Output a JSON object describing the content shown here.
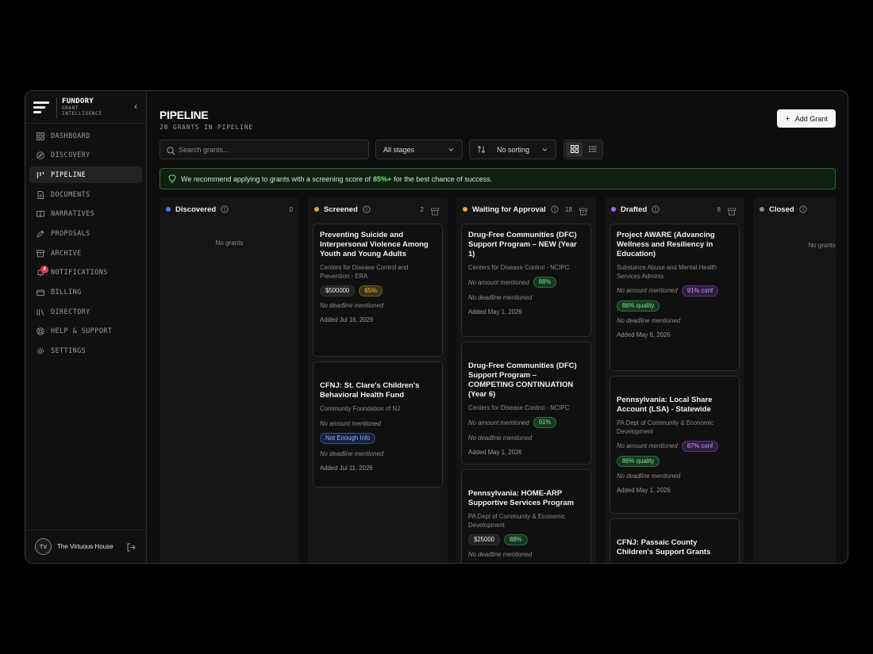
{
  "colors": {
    "discovered": "#3f7df0",
    "screened": "#e8a33d",
    "waiting": "#f0a22e",
    "drafted": "#a861e8",
    "closed": "#8a8a8a",
    "tip_accent": "#7ee081",
    "badge": "#e0324b"
  },
  "brand": {
    "name": "FUNDORY",
    "tagline": "GRANT INTELLIGENCE"
  },
  "sidebar": {
    "items": [
      {
        "label": "DASHBOARD",
        "icon": "grid-icon"
      },
      {
        "label": "DISCOVERY",
        "icon": "compass-icon"
      },
      {
        "label": "PIPELINE",
        "icon": "pipeline-icon",
        "active": true
      },
      {
        "label": "DOCUMENTS",
        "icon": "document-icon"
      },
      {
        "label": "NARRATIVES",
        "icon": "book-icon"
      },
      {
        "label": "PROPOSALS",
        "icon": "pen-icon"
      },
      {
        "label": "ARCHIVE",
        "icon": "archive-icon"
      },
      {
        "label": "NOTIFICATIONS",
        "icon": "bell-icon",
        "badge": "4"
      },
      {
        "label": "BILLING",
        "icon": "card-icon"
      },
      {
        "label": "DIRECTORY",
        "icon": "library-icon"
      },
      {
        "label": "HELP & SUPPORT",
        "icon": "lifebuoy-icon"
      },
      {
        "label": "SETTINGS",
        "icon": "gear-icon"
      }
    ]
  },
  "user": {
    "initials": "TV",
    "name": "The Virtuous House"
  },
  "header": {
    "title": "PIPELINE",
    "subtitle": "28 GRANTS IN PIPELINE",
    "add_label": "Add Grant"
  },
  "toolbar": {
    "search_placeholder": "Search grants...",
    "stage_filter": "All stages",
    "sort": "No sorting",
    "view": "grid"
  },
  "tip": {
    "prefix": "We recommend applying to grants with a screening score of",
    "highlight": "85%+",
    "suffix": "for the best chance of success."
  },
  "columns": {
    "discovered": {
      "title": "Discovered",
      "count": "0",
      "empty": "No grants"
    },
    "screened": {
      "title": "Screened",
      "count": "2",
      "cards": [
        {
          "title": "Preventing Suicide and Interpersonal Violence Among Youth and Young Adults",
          "org": "Centers for Disease Control and Prevention - ERA",
          "amount": "$500000",
          "score": "65%",
          "deadline": "No deadline mentioned",
          "added": "Added Jul 16, 2026"
        },
        {
          "title": "CFNJ: St. Clare's Children's Behavioral Health Fund",
          "org": "Community Foundation of NJ",
          "amount_note": "No amount mentioned",
          "status": "Not Enough Info",
          "deadline": "No deadline mentioned",
          "added": "Added Jul 11, 2026"
        }
      ]
    },
    "waiting": {
      "title": "Waiting for Approval",
      "count": "18",
      "cards": [
        {
          "title": "Drug-Free Communities (DFC) Support Program – NEW (Year 1)",
          "org": "Centers for Disease Control - NCIPC",
          "amount_note": "No amount mentioned",
          "score": "88%",
          "deadline": "No deadline mentioned",
          "added": "Added May 1, 2026"
        },
        {
          "title": "Drug-Free Communities (DFC) Support Program – COMPETING CONTINUATION (Year 6)",
          "org": "Centers for Disease Control - NCIPC",
          "amount_note": "No amount mentioned",
          "score": "91%",
          "deadline": "No deadline mentioned",
          "added": "Added May 1, 2026"
        },
        {
          "title": "Pennsylvania: HOME-ARP Supportive Services Program",
          "org": "PA Dept of Community & Economic Development",
          "amount": "$25000",
          "score": "88%",
          "deadline": "No deadline mentioned"
        }
      ]
    },
    "drafted": {
      "title": "Drafted",
      "count": "8",
      "cards": [
        {
          "title": "Project AWARE (Advancing Wellness and Resiliency in Education)",
          "org": "Substance Abuse and Mental Health Services Adminis",
          "amount_note": "No amount mentioned",
          "conf": "91% conf",
          "quality": "86% quality",
          "deadline": "No deadline mentioned",
          "added": "Added May 6, 2026"
        },
        {
          "title": "Pennsylvania: Local Share Account (LSA) - Statewide",
          "org": "PA Dept of Community & Economic Development",
          "amount_note": "No amount mentioned",
          "conf": "87% conf",
          "quality": "86% quality",
          "deadline": "No deadline mentioned",
          "added": "Added May 1, 2026"
        },
        {
          "title": "CFNJ: Passaic County Children's Support Grants"
        }
      ]
    },
    "closed": {
      "title": "Closed",
      "empty": "No grants"
    }
  }
}
